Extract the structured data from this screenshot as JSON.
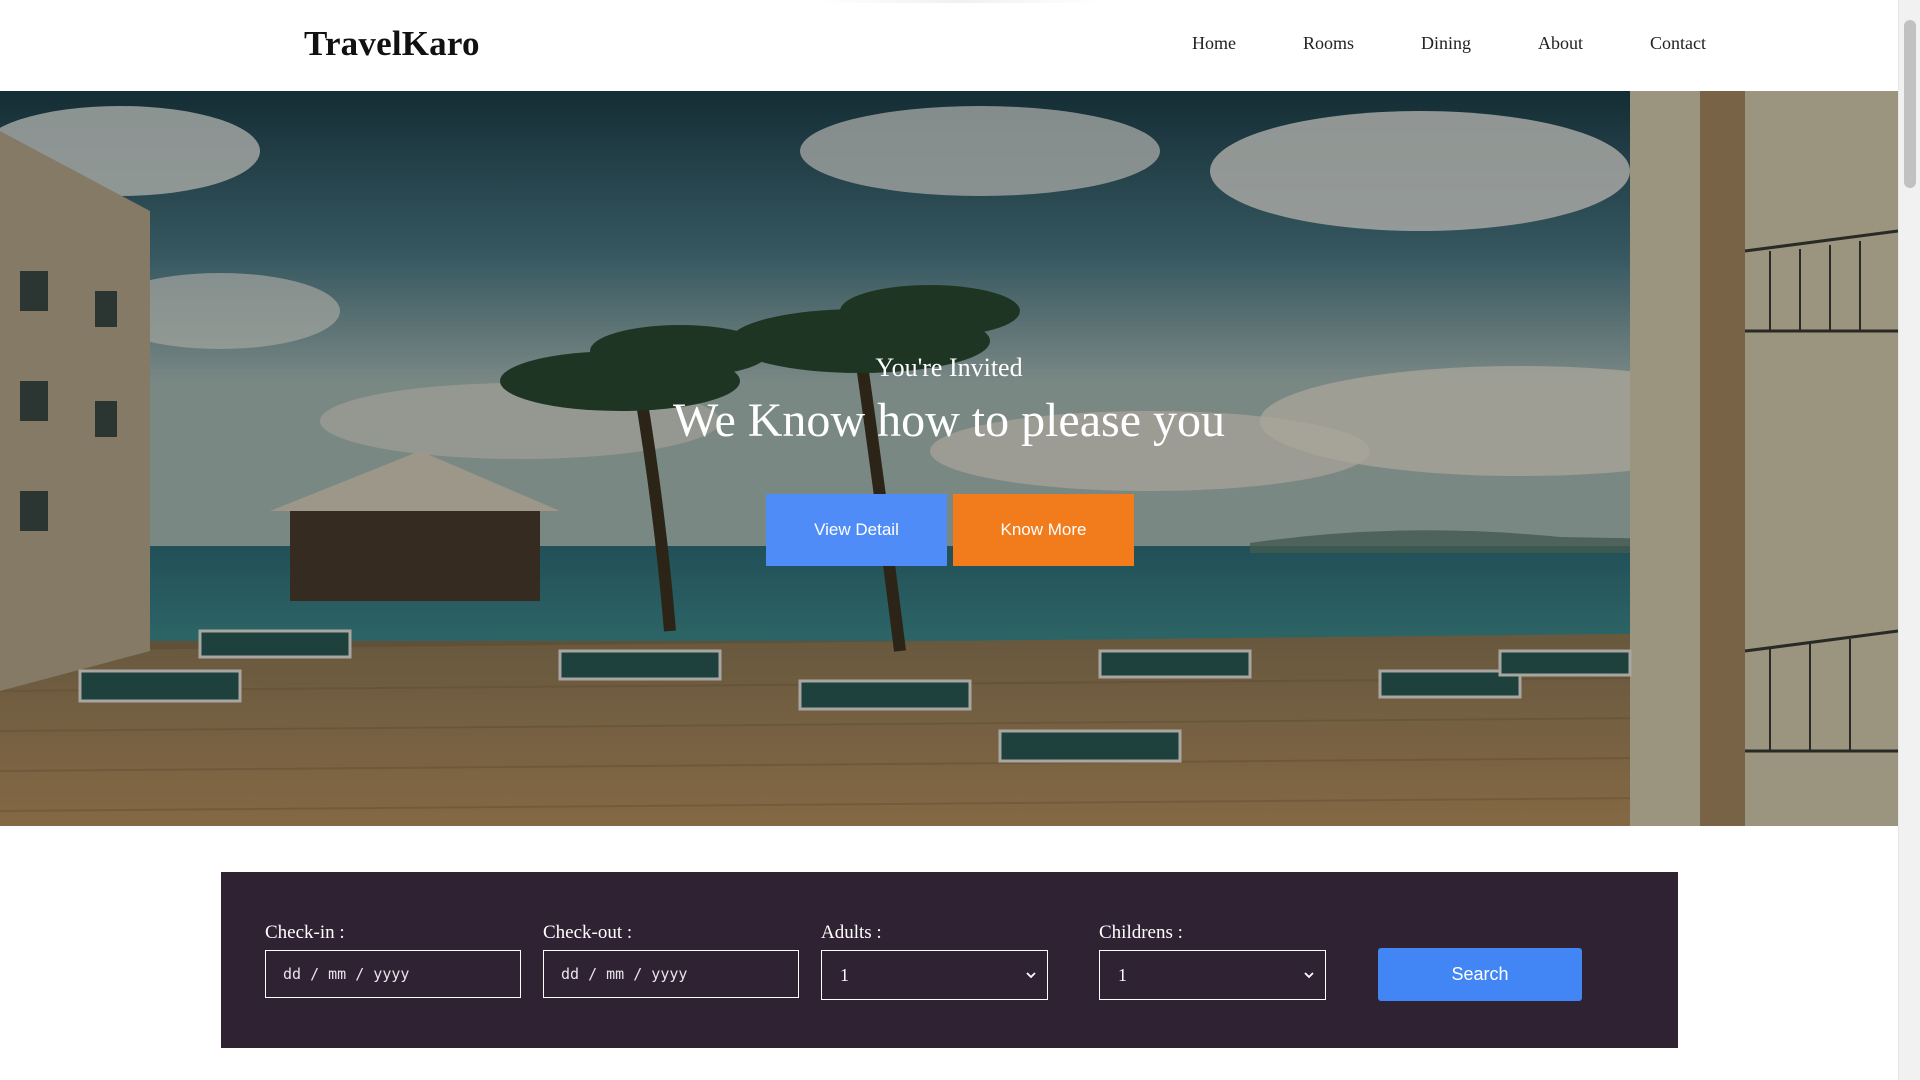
{
  "header": {
    "brand": "TravelKaro",
    "nav": [
      "Home",
      "Rooms",
      "Dining",
      "About",
      "Contact"
    ]
  },
  "hero": {
    "eyebrow": "You're Invited",
    "headline": "We Know how to please you",
    "buttons": {
      "view_detail": "View Detail",
      "know_more": "Know More"
    }
  },
  "booking": {
    "checkin_label": "Check-in :",
    "checkin_placeholder": "dd / mm / yyyy",
    "checkout_label": "Check-out :",
    "checkout_placeholder": "dd / mm / yyyy",
    "adults_label": "Adults :",
    "adults_value": "1",
    "children_label": "Childrens :",
    "children_value": "1",
    "search_label": "Search"
  },
  "colors": {
    "primary_blue": "#4f8cf7",
    "accent_orange": "#f27c1c",
    "panel_bg": "#2f2233",
    "search_blue": "#4285f4"
  },
  "icons": [
    "chevron-down-icon"
  ]
}
